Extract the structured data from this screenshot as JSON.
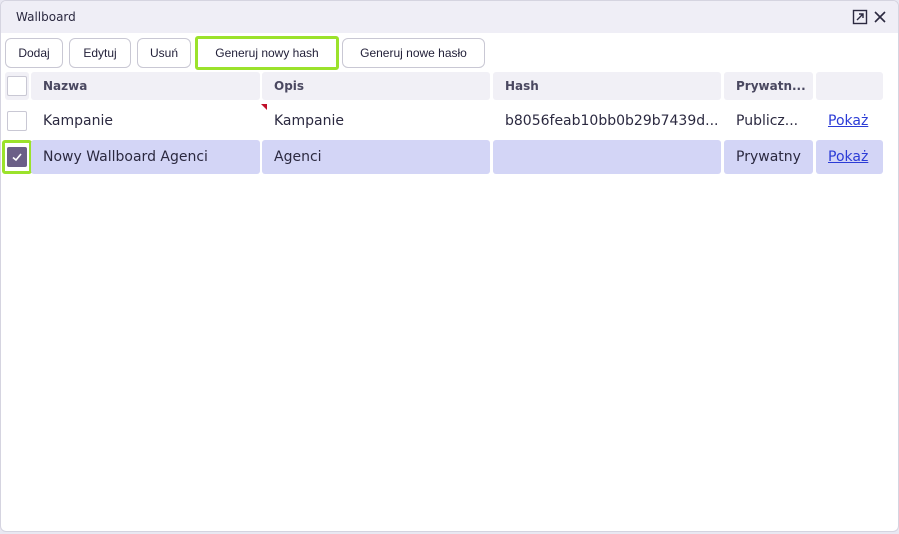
{
  "window": {
    "title": "Wallboard"
  },
  "toolbar": {
    "add": "Dodaj",
    "edit": "Edytuj",
    "delete": "Usuń",
    "new_hash": "Generuj nowy hash",
    "new_password": "Generuj nowe hasło"
  },
  "table": {
    "headers": {
      "name": "Nazwa",
      "desc": "Opis",
      "hash": "Hash",
      "private": "Prywatn...",
      "action": ""
    },
    "rows": [
      {
        "name": "Kampanie",
        "desc": "Kampanie",
        "hash": "b8056feab10bb0b29b7439d...",
        "private": "Publicz...",
        "action": "Pokaż",
        "checked": false
      },
      {
        "name": "Nowy Wallboard Agenci",
        "desc": "Agenci",
        "hash": "",
        "private": "Prywatny",
        "action": "Pokaż",
        "checked": true
      }
    ]
  },
  "colors": {
    "highlight": "#9be22b",
    "selected_row": "#d3d5f6",
    "link": "#2b3bd6",
    "checkbox_checked": "#6b5f87"
  }
}
